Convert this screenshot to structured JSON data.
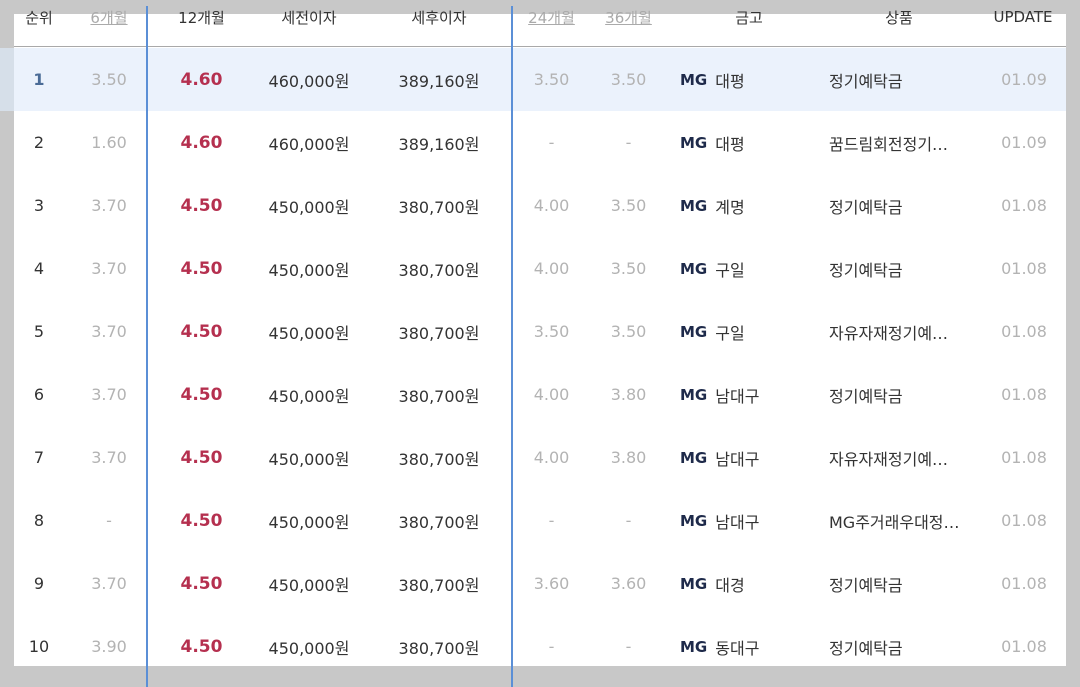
{
  "header": {
    "rank": "순위",
    "m6": "6개월",
    "m12": "12개월",
    "pre_tax": "세전이자",
    "post_tax": "세후이자",
    "m24": "24개월",
    "m36": "36개월",
    "bank": "금고",
    "product": "상품",
    "update": "UPDATE"
  },
  "rows": [
    {
      "rank": "1",
      "m6": "3.50",
      "m12": "4.60",
      "pre": "460,000원",
      "post": "389,160원",
      "m24": "3.50",
      "m36": "3.50",
      "mg": "MG",
      "branch": "대평",
      "product": "정기예탁금",
      "update": "01.09"
    },
    {
      "rank": "2",
      "m6": "1.60",
      "m12": "4.60",
      "pre": "460,000원",
      "post": "389,160원",
      "m24": "-",
      "m36": "-",
      "mg": "MG",
      "branch": "대평",
      "product": "꿈드림회전정기…",
      "update": "01.09"
    },
    {
      "rank": "3",
      "m6": "3.70",
      "m12": "4.50",
      "pre": "450,000원",
      "post": "380,700원",
      "m24": "4.00",
      "m36": "3.50",
      "mg": "MG",
      "branch": "계명",
      "product": "정기예탁금",
      "update": "01.08"
    },
    {
      "rank": "4",
      "m6": "3.70",
      "m12": "4.50",
      "pre": "450,000원",
      "post": "380,700원",
      "m24": "4.00",
      "m36": "3.50",
      "mg": "MG",
      "branch": "구일",
      "product": "정기예탁금",
      "update": "01.08"
    },
    {
      "rank": "5",
      "m6": "3.70",
      "m12": "4.50",
      "pre": "450,000원",
      "post": "380,700원",
      "m24": "3.50",
      "m36": "3.50",
      "mg": "MG",
      "branch": "구일",
      "product": "자유자재정기예…",
      "update": "01.08"
    },
    {
      "rank": "6",
      "m6": "3.70",
      "m12": "4.50",
      "pre": "450,000원",
      "post": "380,700원",
      "m24": "4.00",
      "m36": "3.80",
      "mg": "MG",
      "branch": "남대구",
      "product": "정기예탁금",
      "update": "01.08"
    },
    {
      "rank": "7",
      "m6": "3.70",
      "m12": "4.50",
      "pre": "450,000원",
      "post": "380,700원",
      "m24": "4.00",
      "m36": "3.80",
      "mg": "MG",
      "branch": "남대구",
      "product": "자유자재정기예…",
      "update": "01.08"
    },
    {
      "rank": "8",
      "m6": "-",
      "m12": "4.50",
      "pre": "450,000원",
      "post": "380,700원",
      "m24": "-",
      "m36": "-",
      "mg": "MG",
      "branch": "남대구",
      "product": "MG주거래우대정…",
      "update": "01.08"
    },
    {
      "rank": "9",
      "m6": "3.70",
      "m12": "4.50",
      "pre": "450,000원",
      "post": "380,700원",
      "m24": "3.60",
      "m36": "3.60",
      "mg": "MG",
      "branch": "대경",
      "product": "정기예탁금",
      "update": "01.08"
    },
    {
      "rank": "10",
      "m6": "3.90",
      "m12": "4.50",
      "pre": "450,000원",
      "post": "380,700원",
      "m24": "-",
      "m36": "-",
      "mg": "MG",
      "branch": "동대구",
      "product": "정기예탁금",
      "update": "01.08"
    }
  ],
  "colors": {
    "rate12": "#b5304f",
    "divider": "#5b8fd6",
    "highlight_row": "#ebf2fc",
    "muted": "#b3b3b3"
  }
}
